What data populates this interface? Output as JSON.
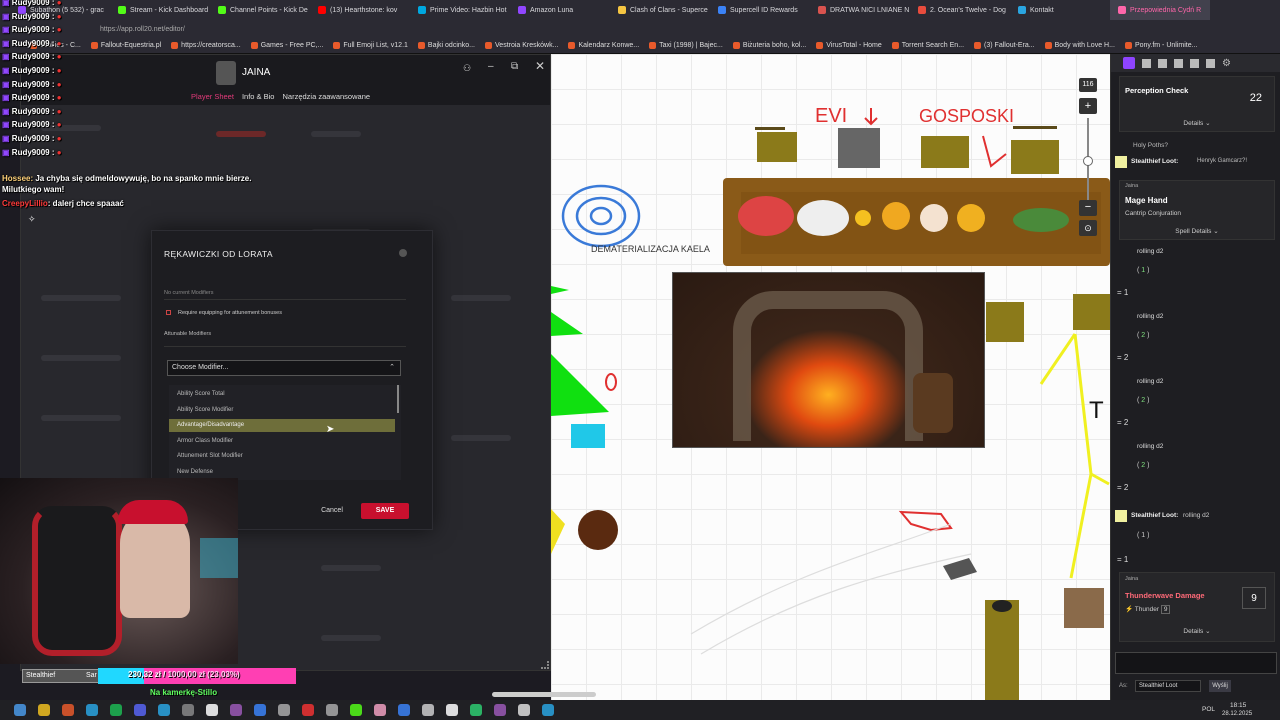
{
  "browser": {
    "tabs": [
      {
        "label": "Subathon (5 532) - grac",
        "color": "#9147ff"
      },
      {
        "label": "Stream - Kick Dashboard",
        "color": "#53fc18"
      },
      {
        "label": "Channel Points - Kick De",
        "color": "#53fc18"
      },
      {
        "label": "(13) Hearthstone: kov",
        "color": "#ff0000"
      },
      {
        "label": "Prime Video: Hazbin Hot",
        "color": "#00a8e1"
      },
      {
        "label": "Amazon Luna",
        "color": "#9146ff"
      },
      {
        "label": "Clash of Clans - Superce",
        "color": "#f5c542"
      },
      {
        "label": "Supercell ID Rewards",
        "color": "#3b82f6"
      },
      {
        "label": "DRATWA NICI LNIANE N",
        "color": "#d9534f"
      },
      {
        "label": "2. Ocean's Twelve - Dog",
        "color": "#e84c3d"
      },
      {
        "label": "Kontakt",
        "color": "#2aa5e0"
      },
      {
        "label": "Przepowiednia Cydń R",
        "color": "#ff66aa",
        "active": true
      }
    ],
    "url": "https://app.roll20.net/editor/",
    "bookmarks": [
      "cookies - C...",
      "Fallout-Equestria.pl",
      "https://creatorsca...",
      "Games - Free PC,...",
      "Full Emoji List, v12.1",
      "Bajki odcinko...",
      "Vestroia Kreskówk...",
      "Kalendarz Konwe...",
      "Taxi (1998) | Bajec...",
      "Biżuteria boho, kol...",
      "VirusTotal - Home",
      "Torrent Search En...",
      "(3) Fallout-Era...",
      "Body with Love H...",
      "Pony.fm - Unlimite..."
    ]
  },
  "overlay": {
    "chat_lines": [
      "Rudy9009 :",
      "Rudy9009 :",
      "Rudy9009 :",
      "Rudy9009 :",
      "Rudy9009 :",
      "Rudy9009 :",
      "Rudy9009 :",
      "Rudy9009 :",
      "Rudy9009 :",
      "Rudy9009 :",
      "Rudy9009 :",
      "Rudy9009 :"
    ],
    "msg1_user": "Hossee:",
    "msg1_text": "Ja chyba się odmeldowywuję, bo na spanko mnie bierze. Milutkiego wam!",
    "msg2_user": "CreepyLillio",
    "msg2_text": ": dalerj chce spaaać",
    "donation_user": "Stealthief",
    "donation_user2": "Sar",
    "goal_current": "230,32 zł /",
    "goal_target": "1000,00 zł (23,03%)",
    "goal_fraction": 0.2303,
    "goal_caption": "Na kamerkę-Stillo"
  },
  "sheet": {
    "character_name": "JAINA",
    "tabs": [
      "Player Sheet",
      "Info & Bio",
      "Narzędzia zaawansowane"
    ],
    "active_tab": "Player Sheet"
  },
  "modal": {
    "title": "RĘKAWICZKI OD LORATA",
    "no_mods": "No current Modifiers",
    "require_attune": "Require equipping for attunement bonuses",
    "attunable": "Attunable Modifiers",
    "choose": "Choose Modifier...",
    "options": [
      "Ability Score Total",
      "Ability Score Modifier",
      "Advantage/Disadvantage",
      "Armor Class Modifier",
      "Attunement Slot Modifier",
      "New Defense"
    ],
    "highlighted": "Advantage/Disadvantage",
    "cancel": "Cancel",
    "save": "SAVE"
  },
  "canvas": {
    "label_evil": "EVI",
    "label_gospodi": "GOSPOSKI",
    "label_dematerial": "DEMATERIALIZACJA KAELA",
    "letter_t": "T",
    "zoom_value": "116"
  },
  "chat": {
    "perception_title": "Perception Check",
    "perception_value": "22",
    "details": "Details",
    "holy": "Holy Poths?",
    "stealth_user": "Stealthief Loot:",
    "stealth_msg": "Henryk Gamcarz?!",
    "jaina": "Jaina",
    "mage_hand": "Mage Hand",
    "mage_sub": "Cantrip Conjuration",
    "spell_details": "Spell Details",
    "rolls": [
      {
        "label": "rolling d2",
        "dice": "1",
        "result": "1"
      },
      {
        "label": "rolling d2",
        "dice": "2",
        "result": "2"
      },
      {
        "label": "rolling d2",
        "dice": "2",
        "result": "2"
      },
      {
        "label": "rolling d2",
        "dice": "2",
        "result": "2"
      }
    ],
    "stealth2_user": "Stealthief Loot:",
    "stealth2_msg": "rolling d2",
    "roll5_dice": "1",
    "roll5_result": "1",
    "jaina2": "Jaina",
    "thunder_title": "Thunderwave Damage",
    "thunder_sub": "Thunder",
    "thunder_sub_val": "9",
    "thunder_value": "9",
    "details2": "Details",
    "as_label": "As:",
    "as_value": "Stealthief Loot",
    "send": "Wyślij"
  },
  "taskbar": {
    "lang": "POL",
    "time": "18:15",
    "date": "28.12.2025"
  },
  "colors": {
    "save_red": "#c8102e",
    "roll20_pink": "#e23a7a",
    "highlight_olive": "#6e6e3a",
    "goal_cyan": "#20d8ff"
  }
}
